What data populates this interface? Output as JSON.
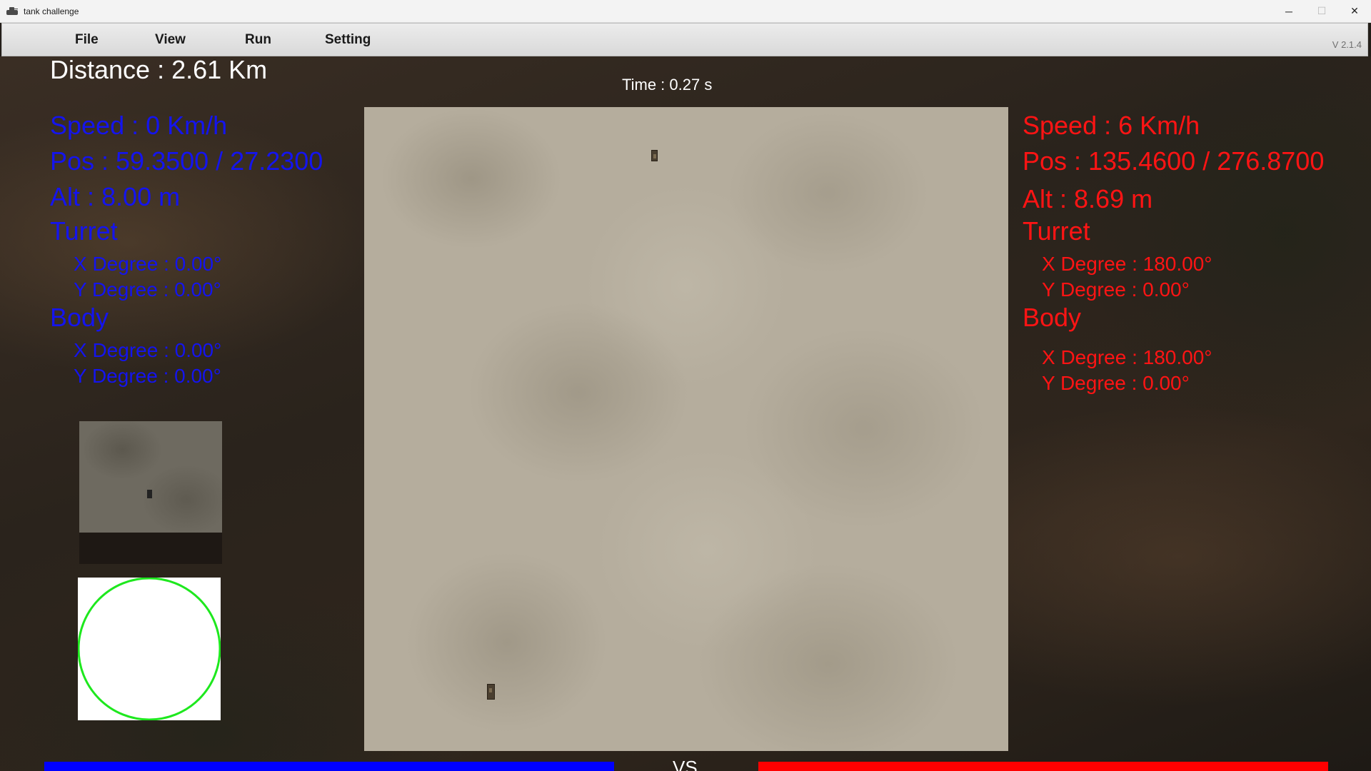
{
  "window": {
    "title": "tank challenge",
    "controls": {
      "minimize": "─",
      "maximize": "☐",
      "close": "✕"
    }
  },
  "menu": {
    "items": [
      "File",
      "View",
      "Run",
      "Setting"
    ],
    "version": "V 2.1.4"
  },
  "hud": {
    "distance": "Distance : 2.61 Km",
    "time": "Time : 0.27 s"
  },
  "blue_tank": {
    "color": "#1414ee",
    "speed": "Speed : 0 Km/h",
    "pos": "Pos : 59.3500 / 27.2300",
    "alt": "Alt : 8.00 m",
    "turret_label": "Turret",
    "turret_x": "X Degree :  0.00°",
    "turret_y": "Y Degree :  0.00°",
    "body_label": "Body",
    "body_x": "X Degree :  0.00°",
    "body_y": "Y Degree :  0.00°"
  },
  "red_tank": {
    "color": "#ff1414",
    "speed": "Speed : 6 Km/h",
    "pos": "Pos : 135.4600 / 276.8700",
    "alt": "Alt : 8.69 m",
    "turret_label": "Turret",
    "turret_x": "X Degree :  180.00°",
    "turret_y": "Y Degree :  0.00°",
    "body_label": "Body",
    "body_x": "X Degree :  180.00°",
    "body_y": "Y Degree :  0.00°"
  },
  "radar": {
    "ring_color": "#1ee81e"
  },
  "bottom": {
    "vs": "VS",
    "blue_health": 1.0,
    "red_health": 1.0
  }
}
